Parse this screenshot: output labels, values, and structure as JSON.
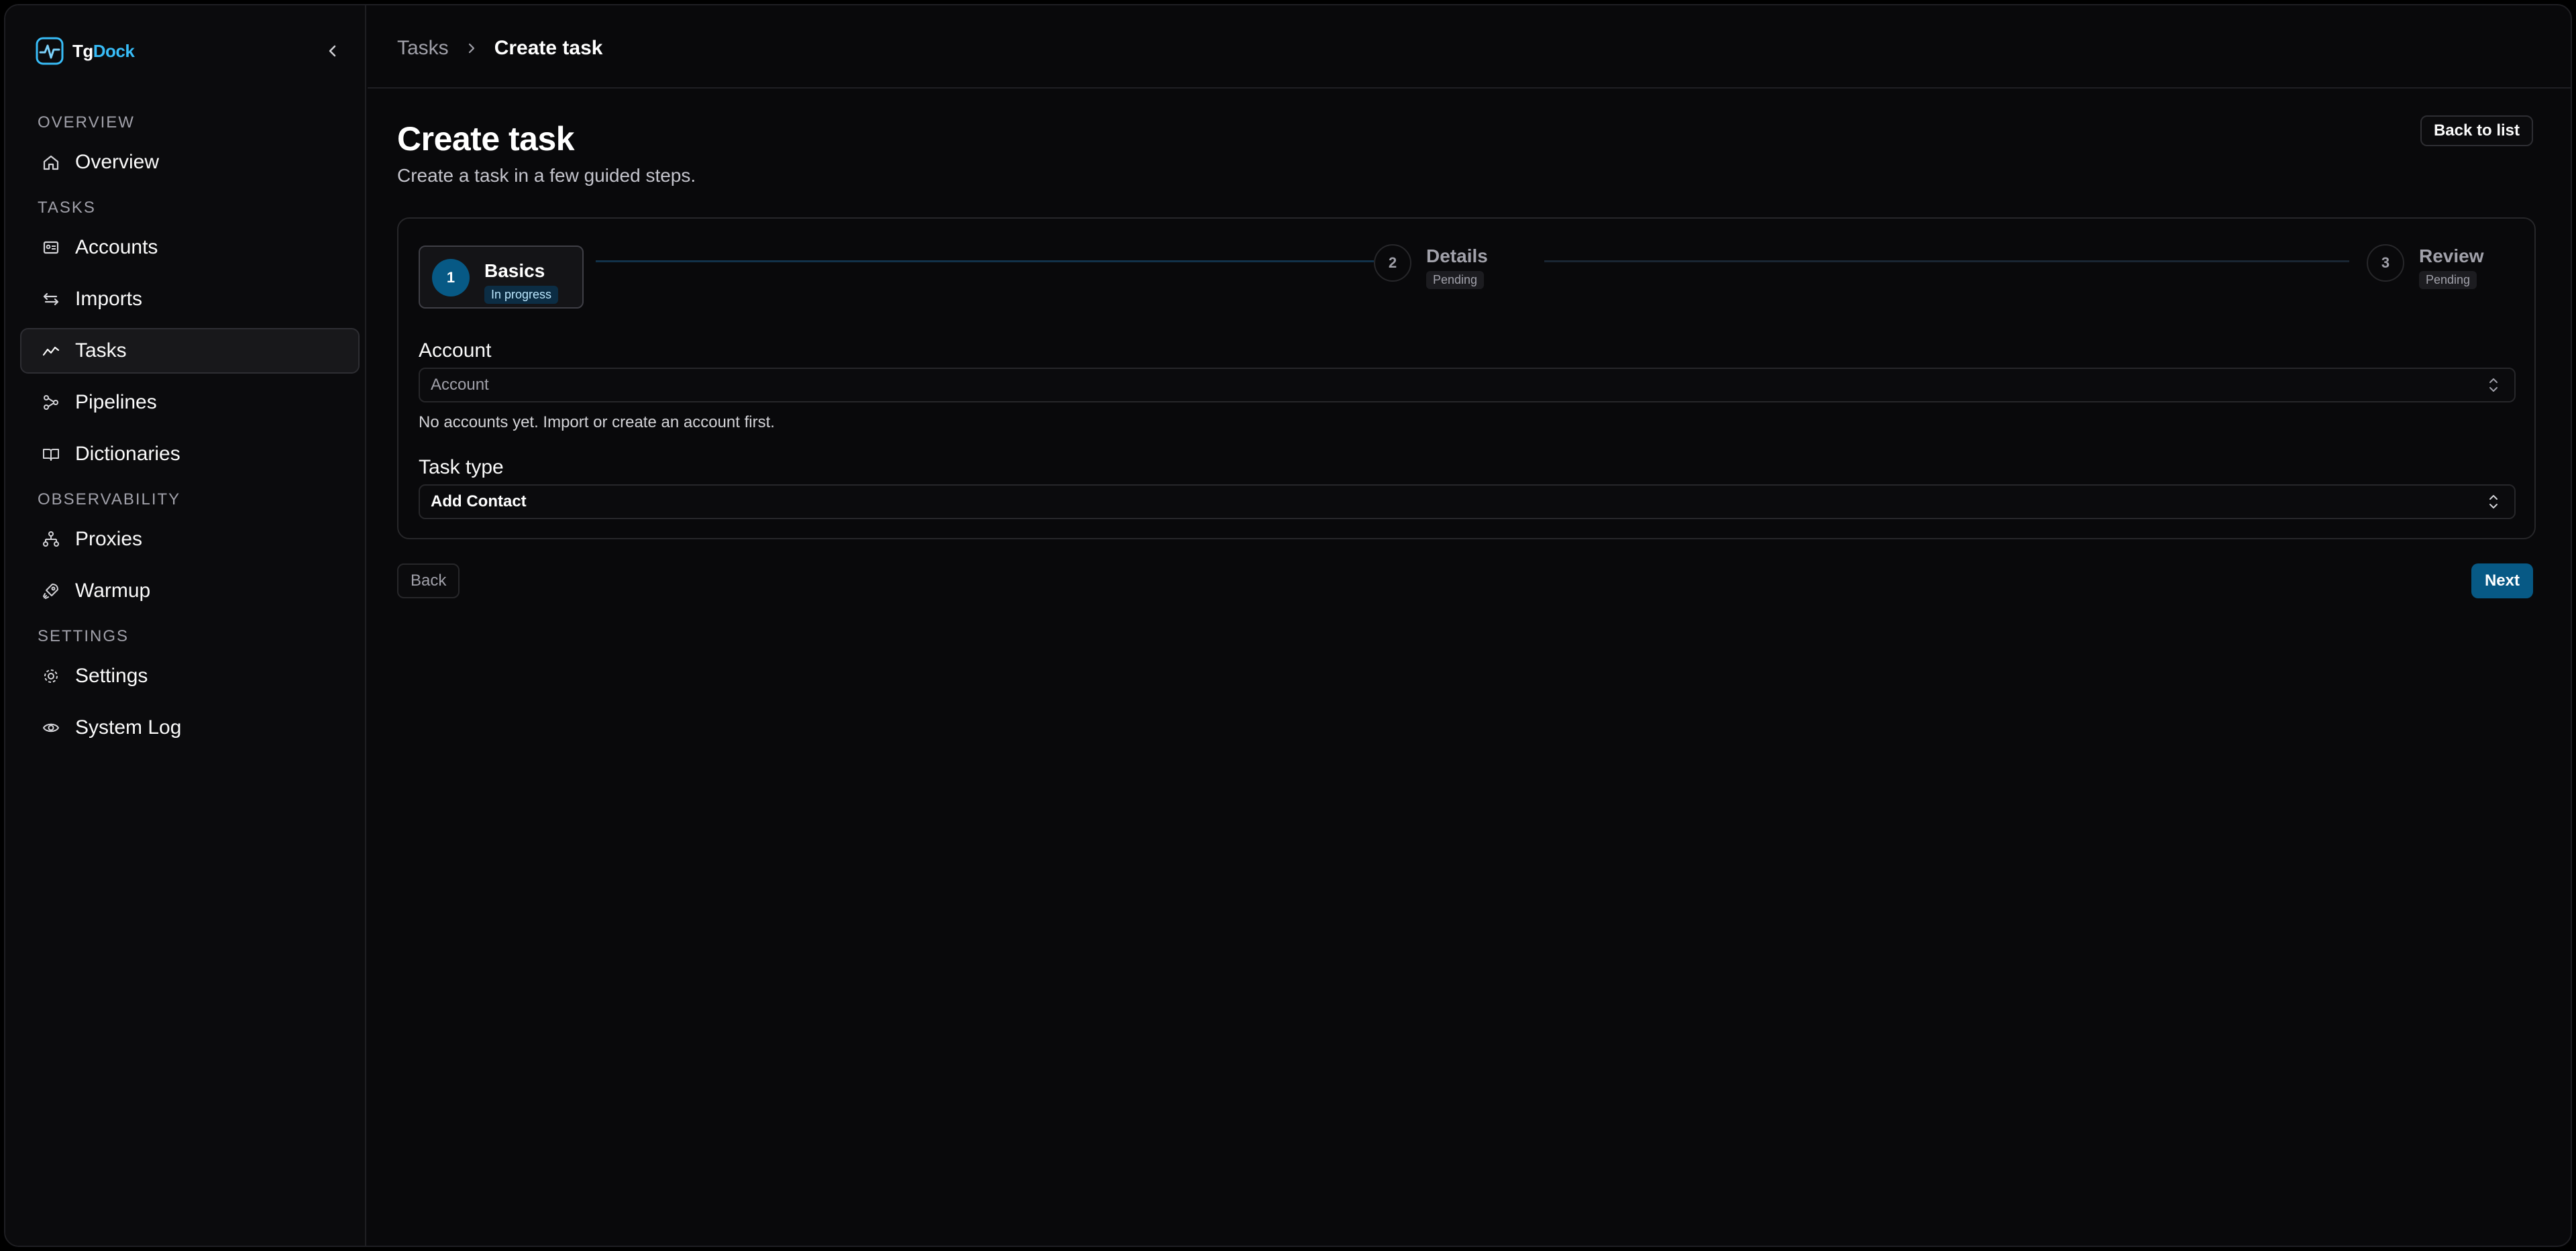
{
  "app": {
    "name_prefix": "Tg",
    "name_suffix": "Dock",
    "logo_icon": "logo-pulse-icon",
    "accent_color": "#075985"
  },
  "sidebar": {
    "collapse_icon": "chevron-left-icon",
    "sections": [
      {
        "title": "OVERVIEW",
        "items": [
          {
            "label": "Overview",
            "icon": "home-icon",
            "active": false
          }
        ]
      },
      {
        "title": "TASKS",
        "items": [
          {
            "label": "Accounts",
            "icon": "id-card-icon",
            "active": false
          },
          {
            "label": "Imports",
            "icon": "arrows-swap-icon",
            "active": false
          },
          {
            "label": "Tasks",
            "icon": "activity-chart-icon",
            "active": true
          },
          {
            "label": "Pipelines",
            "icon": "workflow-icon",
            "active": false
          },
          {
            "label": "Dictionaries",
            "icon": "book-open-icon",
            "active": false
          }
        ]
      },
      {
        "title": "OBSERVABILITY",
        "items": [
          {
            "label": "Proxies",
            "icon": "network-icon",
            "active": false
          },
          {
            "label": "Warmup",
            "icon": "rocket-icon",
            "active": false
          }
        ]
      },
      {
        "title": "SETTINGS",
        "items": [
          {
            "label": "Settings",
            "icon": "gear-icon",
            "active": false
          },
          {
            "label": "System Log",
            "icon": "eye-icon",
            "active": false
          }
        ]
      }
    ]
  },
  "breadcrumb": {
    "parent": "Tasks",
    "separator_icon": "chevron-right-icon",
    "current": "Create task"
  },
  "page": {
    "title": "Create task",
    "subtitle": "Create a task in a few guided steps.",
    "back_to_list": "Back to list"
  },
  "stepper": {
    "steps": [
      {
        "number": "1",
        "label": "Basics",
        "status": "In progress"
      },
      {
        "number": "2",
        "label": "Details",
        "status": "Pending"
      },
      {
        "number": "3",
        "label": "Review",
        "status": "Pending"
      }
    ]
  },
  "form": {
    "account": {
      "label": "Account",
      "placeholder": "Account",
      "help": "No accounts yet. Import or create an account first."
    },
    "task_type": {
      "label": "Task type",
      "value": "Add Contact"
    }
  },
  "actions": {
    "back": "Back",
    "next": "Next"
  }
}
